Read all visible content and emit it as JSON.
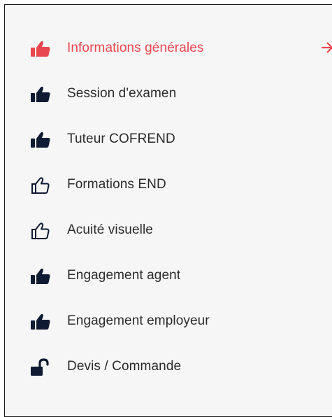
{
  "colors": {
    "active": "#e8474f",
    "icon": "#0f1a33",
    "text": "#2b2b2b",
    "background": "#f6f6f6"
  },
  "nav": {
    "items": [
      {
        "label": "Informations générales",
        "icon": "thumbs-up-solid-icon",
        "active": true
      },
      {
        "label": "Session d'examen",
        "icon": "thumbs-up-solid-icon",
        "active": false
      },
      {
        "label": "Tuteur COFREND",
        "icon": "thumbs-up-solid-icon",
        "active": false
      },
      {
        "label": "Formations END",
        "icon": "thumbs-up-outline-icon",
        "active": false
      },
      {
        "label": "Acuité visuelle",
        "icon": "thumbs-up-outline-icon",
        "active": false
      },
      {
        "label": "Engagement agent",
        "icon": "thumbs-up-solid-icon",
        "active": false
      },
      {
        "label": "Engagement employeur",
        "icon": "thumbs-up-solid-icon",
        "active": false
      },
      {
        "label": "Devis / Commande",
        "icon": "unlock-icon",
        "active": false
      }
    ],
    "active_indicator": "arrow-right-icon"
  }
}
